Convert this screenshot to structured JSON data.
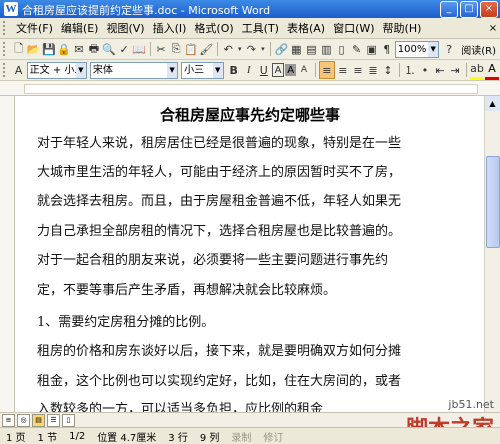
{
  "window": {
    "title": "合租房屋应该提前约定些事.doc - Microsoft Word",
    "app_icon_letter": "W"
  },
  "menu": {
    "items": [
      "文件(F)",
      "编辑(E)",
      "视图(V)",
      "插入(I)",
      "格式(O)",
      "工具(T)",
      "表格(A)",
      "窗口(W)",
      "帮助(H)"
    ],
    "right_controls": [
      "×"
    ]
  },
  "toolbar1": {
    "zoom": "100%",
    "reading_label": "阅读(R)"
  },
  "toolbar2": {
    "style": "正文 + 小三",
    "font": "宋体",
    "size": "小三",
    "bold": "B",
    "italic": "I",
    "underline": "U",
    "char_scale": "A"
  },
  "document": {
    "title": "合租房屋应事先约定哪些事",
    "lines": [
      "对于年轻人来说，租房居住已经是很普遍的现象，特别是在一些",
      "大城市里生活的年轻人，可能由于经济上的原因暂时买不了房，",
      "就会选择去租房。而且，由于房屋租金普遍不低，年轻人如果无",
      "力自己承担全部房租的情况下，选择合租房屋也是比较普遍的。",
      "对于一起合租的朋友来说，必须要将一些主要问题进行事先约",
      "定，不要等事后产生矛盾，再想解决就会比较麻烦。",
      "1、需要约定房租分摊的比例。",
      "租房的价格和房东谈好以后，接下来，就是要明确双方如何分摊",
      "租金，这个比例也可以实现约定好，比如，住在大房间的，或者",
      "入数较多的一方，可以适当多负担，应比例的租金"
    ]
  },
  "status": {
    "page": "1 页",
    "section": "1 节",
    "page_of": "1/2",
    "position": "位置 4.7厘米",
    "line": "3 行",
    "column": "9 列",
    "rec": "录制",
    "trk": "修订"
  },
  "watermark": {
    "site": "jb51.net",
    "brand": "脚本之家"
  }
}
